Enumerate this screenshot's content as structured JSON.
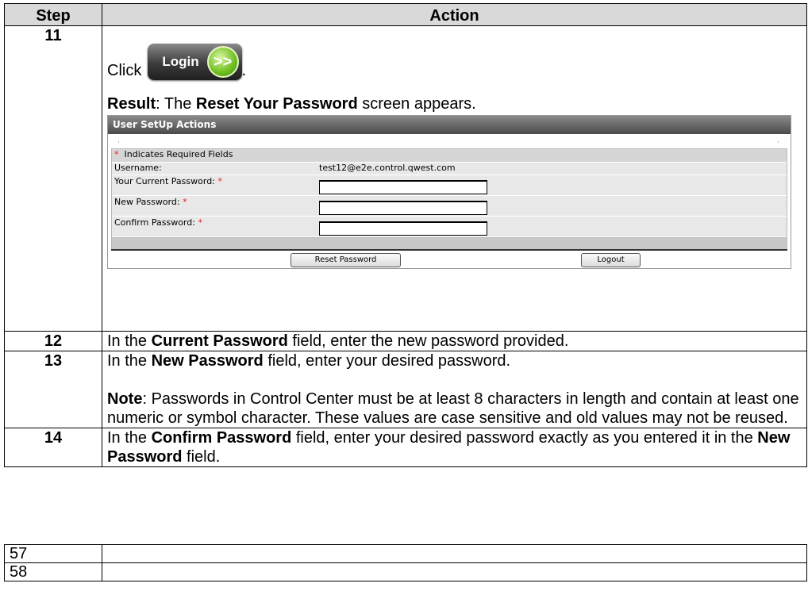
{
  "header": {
    "step": "Step",
    "action": "Action"
  },
  "rows": [
    {
      "step": "11",
      "click": "Click",
      "click_period": ".",
      "login_button": {
        "label": "Login",
        "arrow": ">>"
      },
      "result_label": "Result",
      "result_pre": ":  The ",
      "result_bold": "Reset Your Password",
      "result_post": " screen appears."
    },
    {
      "step": "12",
      "t1": "In the ",
      "b1": "Current Password",
      "t2": " field, enter the new password provided."
    },
    {
      "step": "13",
      "t1": "In the ",
      "b1": "New Password",
      "t2": " field, enter your desired password.",
      "note_label": "Note",
      "note_text": ":  Passwords in Control Center must be at least 8 characters in length and contain at least one numeric or symbol character.  These values are case sensitive and old values may not be reused."
    },
    {
      "step": "14",
      "t1": "In the ",
      "b1": "Confirm Password",
      "t2": " field, enter your desired password exactly as you entered it in the ",
      "b2": "New Password",
      "t3": " field."
    }
  ],
  "screen": {
    "title": "User SetUp Actions",
    "required_note": "Indicates Required Fields",
    "asterisk": "*",
    "username_label": "Username:",
    "username_value": "test12@e2e.control.qwest.com",
    "current_password_label": "Your Current Password:",
    "new_password_label": "New Password:",
    "confirm_password_label": "Confirm Password:",
    "reset_button": "Reset Password",
    "logout_button": "Logout"
  },
  "page_rows": [
    "57",
    "58"
  ]
}
